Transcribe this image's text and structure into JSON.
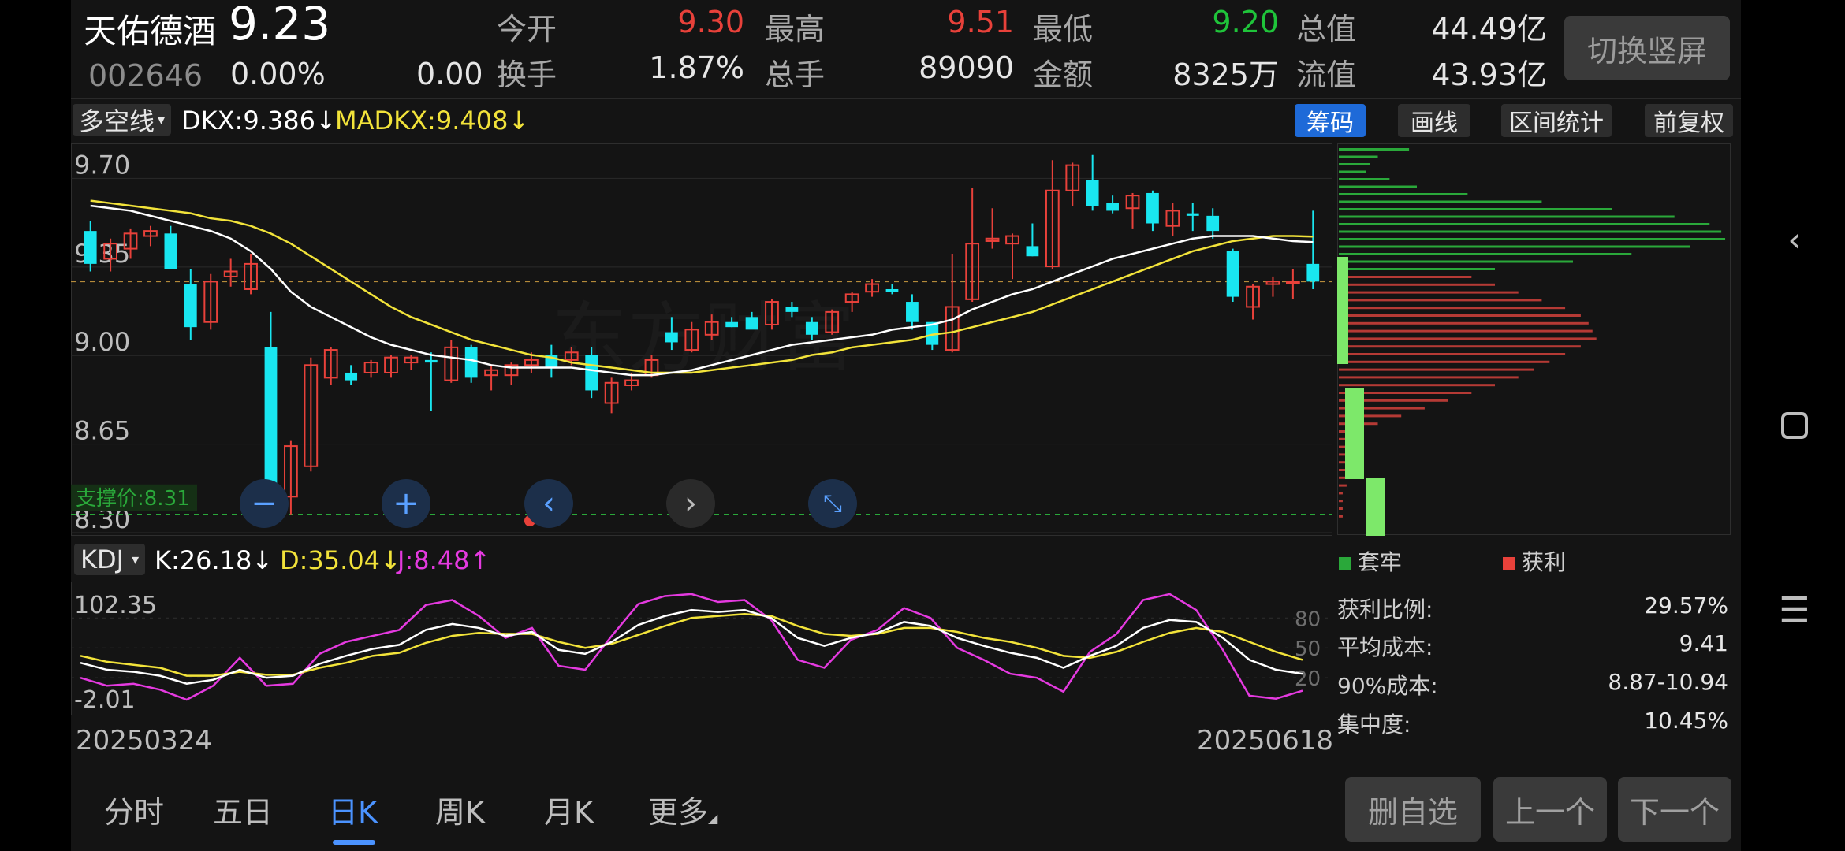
{
  "header": {
    "name": "天佑德酒",
    "price": "9.23",
    "code": "002646",
    "change_pct": "0.00%",
    "change_val": "0.00",
    "portrait_button": "切换竖屏",
    "quotes": [
      {
        "label": "今开",
        "value": "9.30",
        "color": "#e8413a"
      },
      {
        "label": "最高",
        "value": "9.51",
        "color": "#e8413a"
      },
      {
        "label": "最低",
        "value": "9.20",
        "color": "#1fc43a"
      },
      {
        "label": "总值",
        "value": "44.49亿",
        "color": "#e6e6e6"
      },
      {
        "label": "换手",
        "value": "1.87%",
        "color": "#e6e6e6"
      },
      {
        "label": "总手",
        "value": "89090",
        "color": "#e6e6e6"
      },
      {
        "label": "金额",
        "value": "8325万",
        "color": "#e6e6e6"
      },
      {
        "label": "流值",
        "value": "43.93亿",
        "color": "#e6e6e6"
      }
    ]
  },
  "indicator": {
    "selector": "多空线",
    "dkx": "DKX:9.386",
    "madkx": "MADKX:9.408",
    "arrow_down": "↓",
    "tools": [
      "筹码",
      "画线",
      "区间统计",
      "前复权"
    ]
  },
  "price_axis": [
    "9.70",
    "9.35",
    "9.00",
    "8.65",
    "8.30"
  ],
  "support_label": "支撑价:8.31",
  "chip": {
    "legend_trapped": "套牢",
    "legend_profit": "获利",
    "stats": [
      {
        "label": "获利比例:",
        "value": "29.57%"
      },
      {
        "label": "平均成本:",
        "value": "9.41"
      },
      {
        "label": "90%成本:",
        "value": "8.87-10.94"
      },
      {
        "label": "集中度:",
        "value": "10.45%"
      }
    ]
  },
  "kdj": {
    "selector": "KDJ",
    "k": "K:26.18",
    "d": "D:35.04",
    "j": "J:8.48",
    "down": "↓",
    "up": "↑",
    "top": "102.35",
    "bottom": "-2.01",
    "levels": [
      "80",
      "50",
      "20"
    ]
  },
  "dates": {
    "start": "20250324",
    "end": "20250618"
  },
  "tabs": [
    "分时",
    "五日",
    "日K",
    "周K",
    "月K",
    "更多"
  ],
  "active_tab": "日K",
  "bottom_buttons": [
    "删自选",
    "上一个",
    "下一个"
  ],
  "watermark": "东方财富",
  "colors": {
    "up": "#e8413a",
    "down": "#19e6f0",
    "dkx": "#ffffff",
    "madkx": "#f2e33a",
    "j": "#e53ae0",
    "vol_up": "#b53a35",
    "vol_down": "#2aa83a",
    "blue": "#1e6ad8"
  },
  "chart_data": {
    "type": "candlestick",
    "ylim": [
      8.3,
      9.72
    ],
    "candles": [
      {
        "o": 9.43,
        "h": 9.47,
        "l": 9.27,
        "c": 9.3
      },
      {
        "o": 9.32,
        "h": 9.4,
        "l": 9.27,
        "c": 9.38
      },
      {
        "o": 9.36,
        "h": 9.44,
        "l": 9.32,
        "c": 9.42
      },
      {
        "o": 9.41,
        "h": 9.45,
        "l": 9.37,
        "c": 9.43
      },
      {
        "o": 9.42,
        "h": 9.45,
        "l": 9.28,
        "c": 9.28
      },
      {
        "o": 9.22,
        "h": 9.28,
        "l": 9.0,
        "c": 9.05
      },
      {
        "o": 9.07,
        "h": 9.26,
        "l": 9.04,
        "c": 9.23
      },
      {
        "o": 9.25,
        "h": 9.32,
        "l": 9.21,
        "c": 9.27
      },
      {
        "o": 9.2,
        "h": 9.34,
        "l": 9.18,
        "c": 9.3
      },
      {
        "o": 8.97,
        "h": 9.11,
        "l": 8.36,
        "c": 8.4
      },
      {
        "o": 8.38,
        "h": 8.6,
        "l": 8.31,
        "c": 8.58
      },
      {
        "o": 8.5,
        "h": 8.93,
        "l": 8.48,
        "c": 8.9
      },
      {
        "o": 8.85,
        "h": 8.97,
        "l": 8.82,
        "c": 8.96
      },
      {
        "o": 8.87,
        "h": 8.9,
        "l": 8.82,
        "c": 8.84
      },
      {
        "o": 8.87,
        "h": 8.92,
        "l": 8.85,
        "c": 8.91
      },
      {
        "o": 8.87,
        "h": 8.94,
        "l": 8.85,
        "c": 8.93
      },
      {
        "o": 8.91,
        "h": 8.94,
        "l": 8.88,
        "c": 8.93
      },
      {
        "o": 8.92,
        "h": 8.95,
        "l": 8.72,
        "c": 8.91
      },
      {
        "o": 8.84,
        "h": 9.0,
        "l": 8.83,
        "c": 8.97
      },
      {
        "o": 8.97,
        "h": 8.98,
        "l": 8.83,
        "c": 8.85
      },
      {
        "o": 8.86,
        "h": 8.9,
        "l": 8.8,
        "c": 8.88
      },
      {
        "o": 8.86,
        "h": 8.91,
        "l": 8.82,
        "c": 8.9
      },
      {
        "o": 8.9,
        "h": 8.95,
        "l": 8.87,
        "c": 8.92
      },
      {
        "o": 8.94,
        "h": 8.98,
        "l": 8.85,
        "c": 8.89
      },
      {
        "o": 8.92,
        "h": 8.97,
        "l": 8.9,
        "c": 8.95
      },
      {
        "o": 8.94,
        "h": 8.97,
        "l": 8.77,
        "c": 8.8
      },
      {
        "o": 8.75,
        "h": 8.85,
        "l": 8.71,
        "c": 8.83
      },
      {
        "o": 8.82,
        "h": 8.87,
        "l": 8.8,
        "c": 8.84
      },
      {
        "o": 8.86,
        "h": 8.94,
        "l": 8.85,
        "c": 8.92
      },
      {
        "o": 9.03,
        "h": 9.09,
        "l": 8.96,
        "c": 8.99
      },
      {
        "o": 8.96,
        "h": 9.07,
        "l": 8.95,
        "c": 9.04
      },
      {
        "o": 9.02,
        "h": 9.1,
        "l": 9.0,
        "c": 9.07
      },
      {
        "o": 9.07,
        "h": 9.09,
        "l": 9.05,
        "c": 9.05
      },
      {
        "o": 9.09,
        "h": 9.11,
        "l": 9.05,
        "c": 9.04
      },
      {
        "o": 9.06,
        "h": 9.16,
        "l": 9.04,
        "c": 9.15
      },
      {
        "o": 9.13,
        "h": 9.15,
        "l": 9.09,
        "c": 9.11
      },
      {
        "o": 9.07,
        "h": 9.09,
        "l": 9.0,
        "c": 9.02
      },
      {
        "o": 9.03,
        "h": 9.12,
        "l": 9.02,
        "c": 9.11
      },
      {
        "o": 9.15,
        "h": 9.19,
        "l": 9.11,
        "c": 9.18
      },
      {
        "o": 9.19,
        "h": 9.24,
        "l": 9.17,
        "c": 9.22
      },
      {
        "o": 9.2,
        "h": 9.22,
        "l": 9.18,
        "c": 9.19
      },
      {
        "o": 9.15,
        "h": 9.18,
        "l": 9.04,
        "c": 9.07
      },
      {
        "o": 9.07,
        "h": 9.07,
        "l": 8.96,
        "c": 8.98
      },
      {
        "o": 8.96,
        "h": 9.34,
        "l": 8.95,
        "c": 9.13
      },
      {
        "o": 9.16,
        "h": 9.6,
        "l": 9.15,
        "c": 9.38
      },
      {
        "o": 9.39,
        "h": 9.52,
        "l": 9.36,
        "c": 9.4
      },
      {
        "o": 9.38,
        "h": 9.42,
        "l": 9.24,
        "c": 9.41
      },
      {
        "o": 9.37,
        "h": 9.46,
        "l": 9.33,
        "c": 9.33
      },
      {
        "o": 9.29,
        "h": 9.71,
        "l": 9.28,
        "c": 9.59
      },
      {
        "o": 9.59,
        "h": 9.7,
        "l": 9.53,
        "c": 9.69
      },
      {
        "o": 9.63,
        "h": 9.73,
        "l": 9.51,
        "c": 9.53
      },
      {
        "o": 9.54,
        "h": 9.57,
        "l": 9.5,
        "c": 9.51
      },
      {
        "o": 9.52,
        "h": 9.58,
        "l": 9.44,
        "c": 9.57
      },
      {
        "o": 9.58,
        "h": 9.59,
        "l": 9.43,
        "c": 9.46
      },
      {
        "o": 9.45,
        "h": 9.54,
        "l": 9.41,
        "c": 9.51
      },
      {
        "o": 9.5,
        "h": 9.54,
        "l": 9.43,
        "c": 9.49
      },
      {
        "o": 9.49,
        "h": 9.52,
        "l": 9.4,
        "c": 9.43
      },
      {
        "o": 9.35,
        "h": 9.36,
        "l": 9.15,
        "c": 9.17
      },
      {
        "o": 9.13,
        "h": 9.22,
        "l": 9.08,
        "c": 9.21
      },
      {
        "o": 9.22,
        "h": 9.25,
        "l": 9.17,
        "c": 9.23
      },
      {
        "o": 9.23,
        "h": 9.28,
        "l": 9.16,
        "c": 9.23
      },
      {
        "o": 9.3,
        "h": 9.51,
        "l": 9.2,
        "c": 9.23
      }
    ],
    "dkx": [
      9.53,
      9.52,
      9.51,
      9.49,
      9.47,
      9.45,
      9.43,
      9.4,
      9.35,
      9.28,
      9.19,
      9.13,
      9.09,
      9.05,
      9.01,
      8.98,
      8.96,
      8.94,
      8.93,
      8.92,
      8.9,
      8.89,
      8.89,
      8.89,
      8.89,
      8.88,
      8.87,
      8.86,
      8.86,
      8.87,
      8.88,
      8.9,
      8.92,
      8.94,
      8.96,
      8.98,
      8.99,
      9.0,
      9.01,
      9.02,
      9.04,
      9.05,
      9.06,
      9.08,
      9.12,
      9.15,
      9.18,
      9.2,
      9.23,
      9.26,
      9.29,
      9.32,
      9.34,
      9.36,
      9.38,
      9.4,
      9.41,
      9.41,
      9.41,
      9.4,
      9.39,
      9.386
    ],
    "madkx": [
      9.55,
      9.54,
      9.53,
      9.52,
      9.51,
      9.5,
      9.48,
      9.47,
      9.45,
      9.42,
      9.38,
      9.33,
      9.28,
      9.23,
      9.18,
      9.13,
      9.09,
      9.06,
      9.03,
      9.0,
      8.98,
      8.96,
      8.94,
      8.93,
      8.91,
      8.9,
      8.89,
      8.88,
      8.87,
      8.87,
      8.87,
      8.88,
      8.89,
      8.9,
      8.91,
      8.92,
      8.94,
      8.95,
      8.97,
      8.98,
      8.99,
      9.0,
      9.02,
      9.03,
      9.05,
      9.07,
      9.09,
      9.11,
      9.14,
      9.17,
      9.2,
      9.23,
      9.26,
      9.29,
      9.32,
      9.35,
      9.37,
      9.39,
      9.4,
      9.41,
      9.41,
      9.408
    ],
    "kdj_ylim": [
      -2.01,
      102.35
    ],
    "k": [
      35,
      28,
      26,
      22,
      14,
      18,
      28,
      20,
      22,
      34,
      42,
      49,
      53,
      68,
      74,
      70,
      62,
      66,
      48,
      44,
      56,
      73,
      82,
      88,
      86,
      88,
      80,
      60,
      52,
      60,
      65,
      76,
      72,
      60,
      52,
      45,
      40,
      30,
      42,
      52,
      70,
      78,
      76,
      60,
      38,
      28,
      24
    ],
    "d": [
      42,
      36,
      33,
      30,
      22,
      22,
      26,
      23,
      23,
      30,
      35,
      42,
      45,
      55,
      62,
      65,
      64,
      64,
      56,
      50,
      54,
      63,
      72,
      80,
      82,
      84,
      82,
      72,
      64,
      62,
      64,
      70,
      70,
      66,
      60,
      56,
      50,
      42,
      40,
      46,
      56,
      65,
      70,
      66,
      56,
      46,
      38
    ],
    "j": [
      20,
      12,
      14,
      8,
      -2,
      12,
      40,
      12,
      14,
      44,
      56,
      62,
      68,
      93,
      98,
      82,
      60,
      70,
      32,
      28,
      62,
      94,
      102,
      104,
      96,
      98,
      78,
      38,
      30,
      58,
      68,
      90,
      80,
      50,
      38,
      24,
      20,
      6,
      46,
      64,
      98,
      104,
      88,
      48,
      2,
      -1,
      7
    ]
  }
}
